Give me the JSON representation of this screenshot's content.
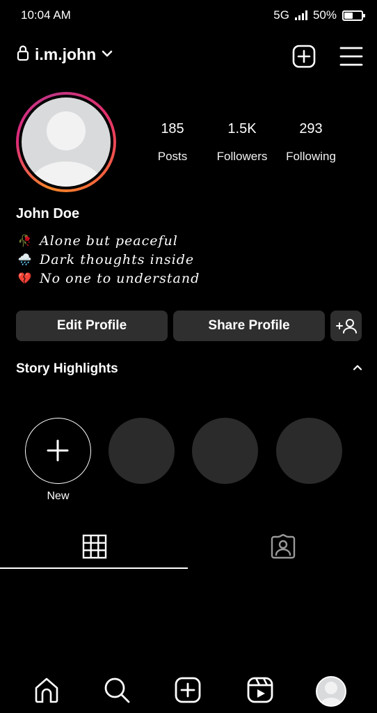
{
  "status_bar": {
    "time": "10:04 AM",
    "network": "5G",
    "battery_percent": "50%",
    "battery_level": 0.5
  },
  "top_bar": {
    "username": "i.m.john",
    "lock_icon": "lock-icon",
    "dropdown_icon": "chevron-down-icon",
    "create_icon": "add-square-icon",
    "menu_icon": "hamburger-menu-icon"
  },
  "profile": {
    "stats": [
      {
        "value": "185",
        "label": "Posts"
      },
      {
        "value": "1.5K",
        "label": "Followers"
      },
      {
        "value": "293",
        "label": "Following"
      }
    ],
    "display_name": "John Doe",
    "bio": [
      {
        "emoji": "🥀",
        "text": "Alone but peaceful"
      },
      {
        "emoji": "🌧️",
        "text": "Dark thoughts inside"
      },
      {
        "emoji": "💔",
        "text": "No one to understand"
      }
    ]
  },
  "actions": {
    "edit_profile": "Edit Profile",
    "share_profile": "Share Profile",
    "discover_icon": "add-person-icon"
  },
  "highlights": {
    "title": "Story Highlights",
    "new_label": "New"
  },
  "tabs": {
    "active": "grid",
    "items": [
      "grid-icon",
      "tagged-icon"
    ]
  },
  "bottom_nav": {
    "items": [
      "home-icon",
      "search-icon",
      "create-icon",
      "reels-icon",
      "profile-avatar"
    ]
  },
  "colors": {
    "background": "#000000",
    "button": "#2f2f2f",
    "highlight_placeholder": "#2b2b2b",
    "avatar_placeholder": "#d9dadc"
  }
}
